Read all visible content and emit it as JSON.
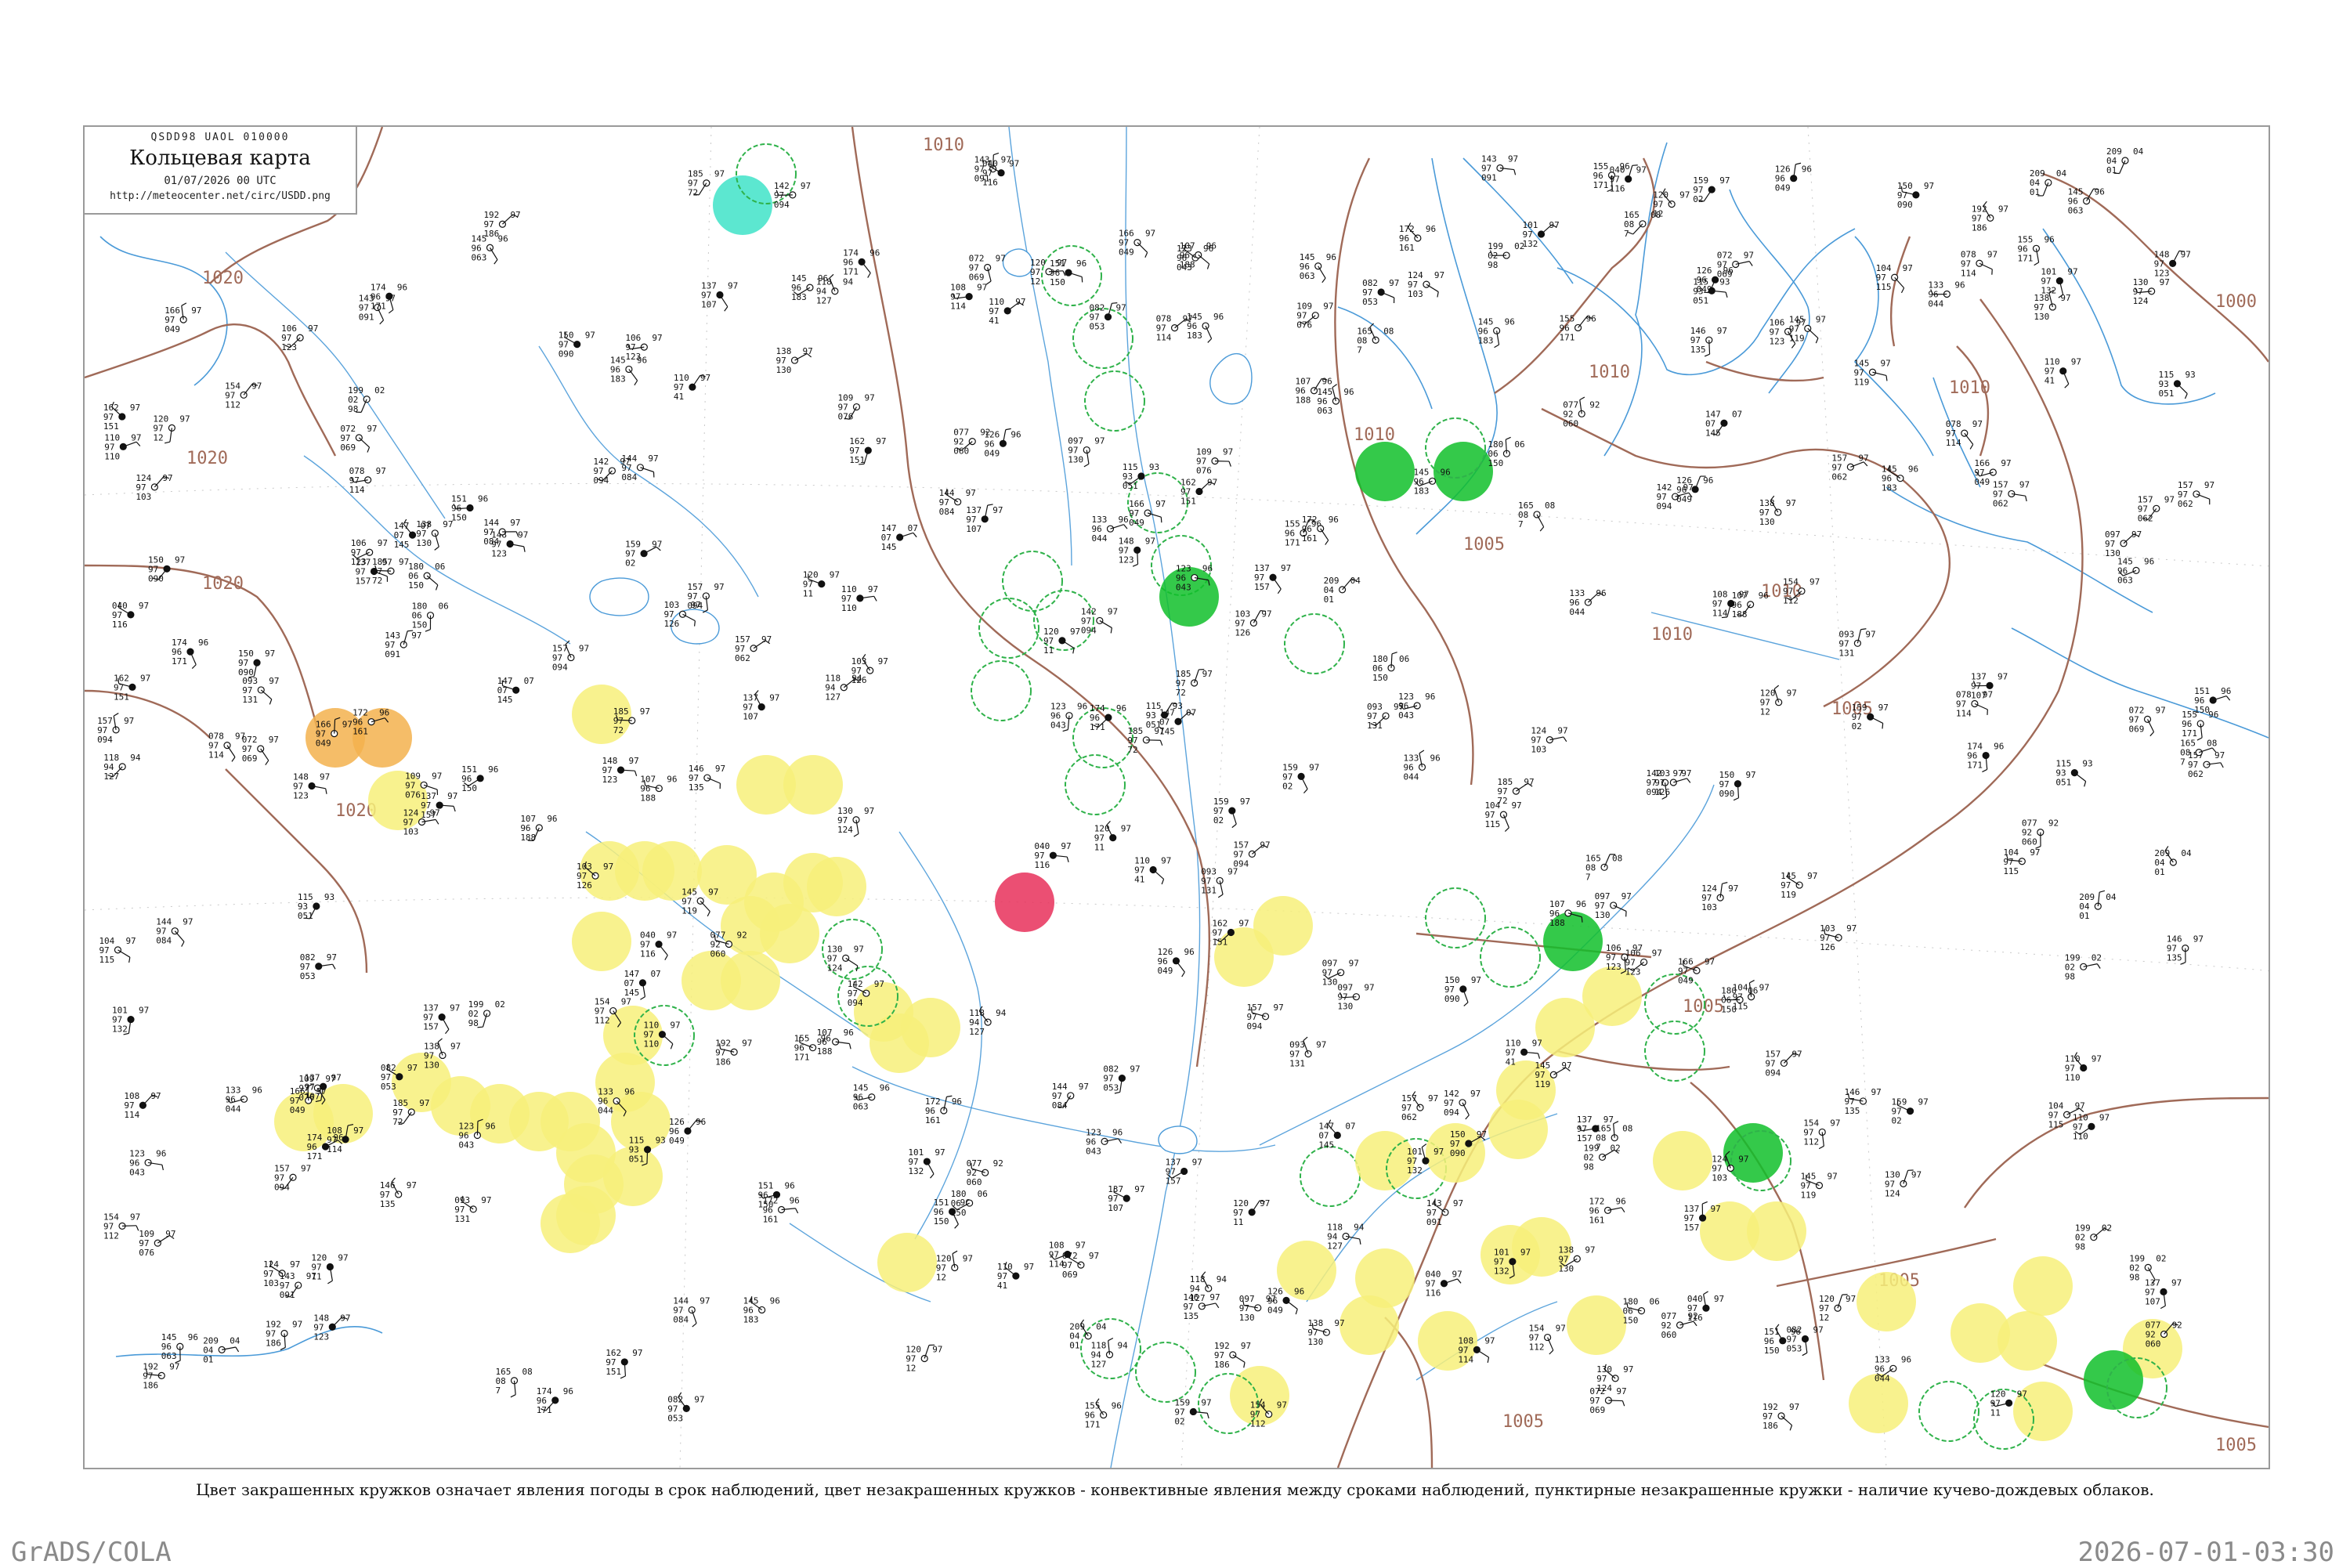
{
  "header": {
    "code_line": "QSDD98  UAOL  010000",
    "title": "Кольцевая карта",
    "date": "01/07/2026 00 UTC",
    "url": "http://meteocenter.net/circ/USDD.png"
  },
  "caption": "Цвет закрашенных кружков означает явления погоды в срок наблюдений, цвет незакрашенных кружков - конвективные явления между сроками наблюдений, пунктирные незакрашенные кружки - наличие кучево-дождевых облаков.",
  "footer": {
    "left": "GrADS/COLA",
    "right": "2026-07-01-03:30"
  },
  "isobar_labels": [
    "1010",
    "1020",
    "1020",
    "1020",
    "1020",
    "1020",
    "1010",
    "1005",
    "1010",
    "1010",
    "1005",
    "1005",
    "1005",
    "1005",
    "1005",
    "1010",
    "1010",
    "1000"
  ],
  "colors": {
    "isobar": "#a06a58",
    "water": "#4a9ad8",
    "rain_yellow": "#f7f07a",
    "fog_orange": "#f3b24d",
    "thunder_red": "#e8305a",
    "shower_green": "#10c02a",
    "snow_cyan": "#3fe3c8",
    "convective_ring": "#2fb24a",
    "frame": "#9a9a9a"
  },
  "stations": [
    {
      "a": "110",
      "b": "97",
      "c": "41"
    },
    {
      "a": "185",
      "b": "97",
      "c": "72"
    },
    {
      "a": "124",
      "b": "97",
      "c": "103"
    },
    {
      "a": "137",
      "b": "97",
      "c": "107"
    },
    {
      "a": "199",
      "b": "02",
      "c": "98"
    },
    {
      "a": "154",
      "b": "97",
      "c": "112"
    },
    {
      "a": "159",
      "b": "97",
      "c": "02"
    },
    {
      "a": "209",
      "b": "04",
      "c": "01"
    },
    {
      "a": "172",
      "b": "96",
      "c": "161"
    },
    {
      "a": "147",
      "b": "07",
      "c": "145"
    },
    {
      "a": "165",
      "b": "08",
      "c": "7"
    },
    {
      "a": "155",
      "b": "96",
      "c": "171"
    },
    {
      "a": "137",
      "b": "97",
      "c": "157"
    },
    {
      "a": "107",
      "b": "96",
      "c": "188"
    },
    {
      "a": "192",
      "b": "97",
      "c": "186"
    },
    {
      "a": "174",
      "b": "96",
      "c": "171"
    },
    {
      "a": "180",
      "b": "06",
      "c": "150"
    },
    {
      "a": "145",
      "b": "96",
      "c": "183"
    },
    {
      "a": "151",
      "b": "96",
      "c": "150"
    },
    {
      "a": "118",
      "b": "94",
      "c": "127"
    },
    {
      "a": "145",
      "b": "96",
      "c": "063"
    },
    {
      "a": "115",
      "b": "93",
      "c": "051"
    },
    {
      "a": "123",
      "b": "96",
      "c": "043"
    },
    {
      "a": "133",
      "b": "96",
      "c": "044"
    },
    {
      "a": "126",
      "b": "96",
      "c": "049"
    },
    {
      "a": "077",
      "b": "92",
      "c": "060"
    },
    {
      "a": "166",
      "b": "97",
      "c": "049"
    },
    {
      "a": "150",
      "b": "97",
      "c": "090"
    },
    {
      "a": "157",
      "b": "97",
      "c": "094"
    },
    {
      "a": "142",
      "b": "97",
      "c": "094"
    },
    {
      "a": "040",
      "b": "97",
      "c": "116"
    },
    {
      "a": "120",
      "b": "97",
      "c": "12"
    },
    {
      "a": "072",
      "b": "97",
      "c": "069"
    },
    {
      "a": "082",
      "b": "97",
      "c": "053"
    },
    {
      "a": "157",
      "b": "97",
      "c": "062"
    },
    {
      "a": "138",
      "b": "97",
      "c": "130"
    },
    {
      "a": "101",
      "b": "97",
      "c": "132"
    },
    {
      "a": "145",
      "b": "97",
      "c": "119"
    },
    {
      "a": "130",
      "b": "97",
      "c": "124"
    },
    {
      "a": "120",
      "b": "97",
      "c": "11"
    },
    {
      "a": "109",
      "b": "97",
      "c": "076"
    },
    {
      "a": "146",
      "b": "97",
      "c": "135"
    },
    {
      "a": "162",
      "b": "97",
      "c": "151"
    },
    {
      "a": "106",
      "b": "97",
      "c": "123"
    },
    {
      "a": "104",
      "b": "97",
      "c": "115"
    },
    {
      "a": "108",
      "b": "97",
      "c": "114"
    },
    {
      "a": "143",
      "b": "97",
      "c": "091"
    },
    {
      "a": "144",
      "b": "97",
      "c": "084"
    },
    {
      "a": "110",
      "b": "97",
      "c": "110"
    },
    {
      "a": "103",
      "b": "97",
      "c": "126"
    },
    {
      "a": "078",
      "b": "97",
      "c": "114"
    },
    {
      "a": "148",
      "b": "97",
      "c": "123"
    },
    {
      "a": "093",
      "b": "97",
      "c": "131"
    },
    {
      "a": "097",
      "b": "97",
      "c": "130"
    }
  ]
}
